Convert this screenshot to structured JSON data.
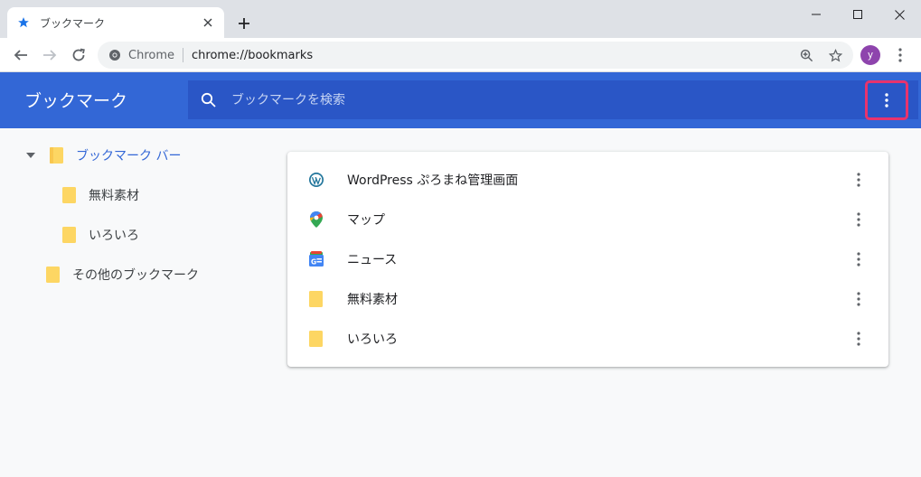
{
  "tab": {
    "title": "ブックマーク"
  },
  "omnibox": {
    "site": "Chrome",
    "url": "chrome://bookmarks"
  },
  "profile": {
    "initial": "y"
  },
  "header": {
    "title": "ブックマーク",
    "search_placeholder": "ブックマークを検索"
  },
  "sidebar": {
    "items": [
      {
        "label": "ブックマーク バー",
        "expanded": true,
        "selected": true
      },
      {
        "label": "無料素材"
      },
      {
        "label": "いろいろ"
      },
      {
        "label": "その他のブックマーク"
      }
    ]
  },
  "list": {
    "rows": [
      {
        "label": "WordPress ぷろまね管理画面",
        "icon": "wordpress-icon"
      },
      {
        "label": "マップ",
        "icon": "google-maps-icon"
      },
      {
        "label": "ニュース",
        "icon": "google-news-icon"
      },
      {
        "label": "無料素材",
        "icon": "folder-icon"
      },
      {
        "label": "いろいろ",
        "icon": "folder-icon"
      }
    ]
  },
  "colors": {
    "header": "#3367d6",
    "search": "#2a56c6",
    "highlight": "#e8336d",
    "folder": "#fdd663",
    "avatar": "#8e44ad"
  }
}
